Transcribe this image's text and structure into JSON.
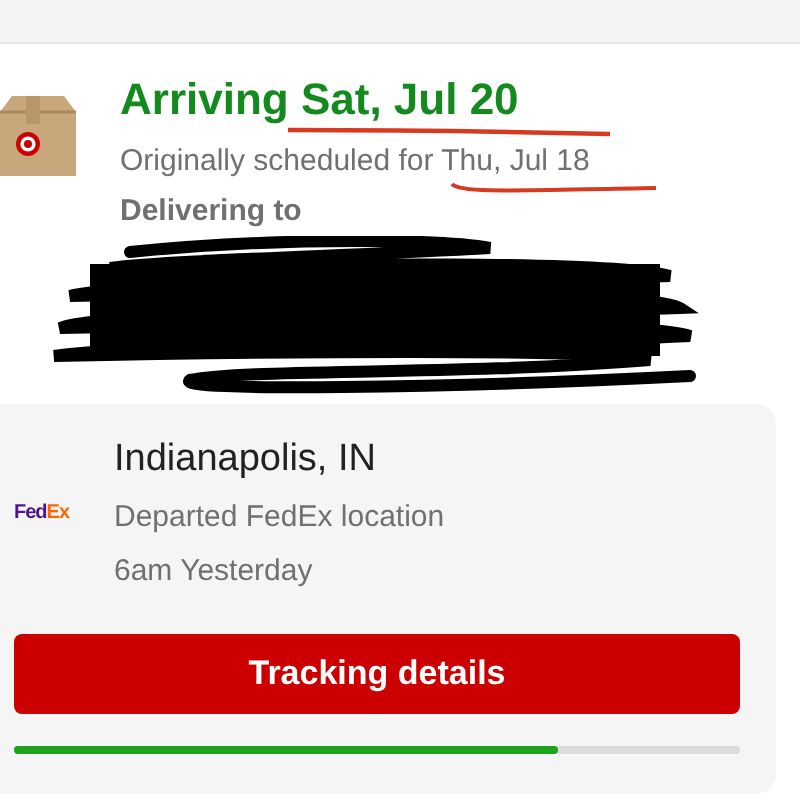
{
  "delivery": {
    "status": "Arriving Sat, Jul 20",
    "original": "Originally scheduled for Thu, Jul 18",
    "delivering_label": "Delivering to"
  },
  "tracking": {
    "location": "Indianapolis, IN",
    "event": "Departed FedEx location",
    "time": "6am Yesterday",
    "carrier_logo": "FedEx",
    "button": "Tracking details",
    "progress": {
      "level": 0.75
    }
  }
}
